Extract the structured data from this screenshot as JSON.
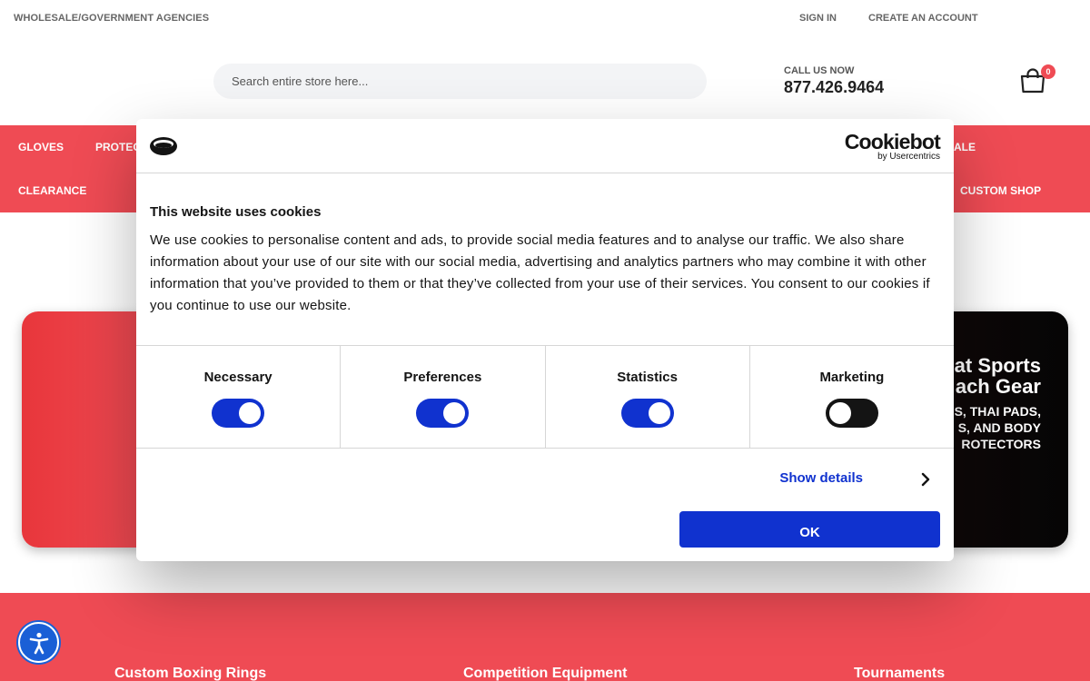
{
  "topbar": {
    "wholesale": "WHOLESALE/GOVERNMENT AGENCIES",
    "sign_in": "SIGN IN",
    "create_account": "CREATE AN ACCOUNT"
  },
  "header": {
    "search_placeholder": "Search entire store here...",
    "call_label": "CALL US NOW",
    "phone": "877.426.9464",
    "cart_count": "0"
  },
  "nav": {
    "items": [
      "GLOVES",
      "PROTEC",
      "ALE",
      "CLEARANCE",
      "CUSTOM SHOP"
    ]
  },
  "banner": {
    "headline_line1": "at Sports",
    "headline_line2": "ach Gear",
    "sub_line1": "S, THAI PADS,",
    "sub_line2": "S, AND BODY",
    "sub_line3": "ROTECTORS"
  },
  "footer": {
    "links": [
      "Custom Boxing Rings",
      "Competition Equipment",
      "Tournaments"
    ]
  },
  "cookie_dialog": {
    "brand": "Cookiebot",
    "brand_sub": "by Usercentrics",
    "title": "This website uses cookies",
    "body": "We use cookies to personalise content and ads, to provide social media features and to analyse our traffic. We also share information about your use of our site with our social media, advertising and analytics partners who may combine it with other information that you’ve provided to them or that they’ve collected from your use of their services. You consent to our cookies if you continue to use our website.",
    "toggles": [
      {
        "label": "Necessary",
        "on": true
      },
      {
        "label": "Preferences",
        "on": true
      },
      {
        "label": "Statistics",
        "on": true
      },
      {
        "label": "Marketing",
        "on": false
      }
    ],
    "show_details": "Show details",
    "ok": "OK"
  },
  "colors": {
    "brand_red": "#ef4b54",
    "cookie_blue": "#1032cf",
    "accessibility_blue": "#1a5fd6"
  }
}
